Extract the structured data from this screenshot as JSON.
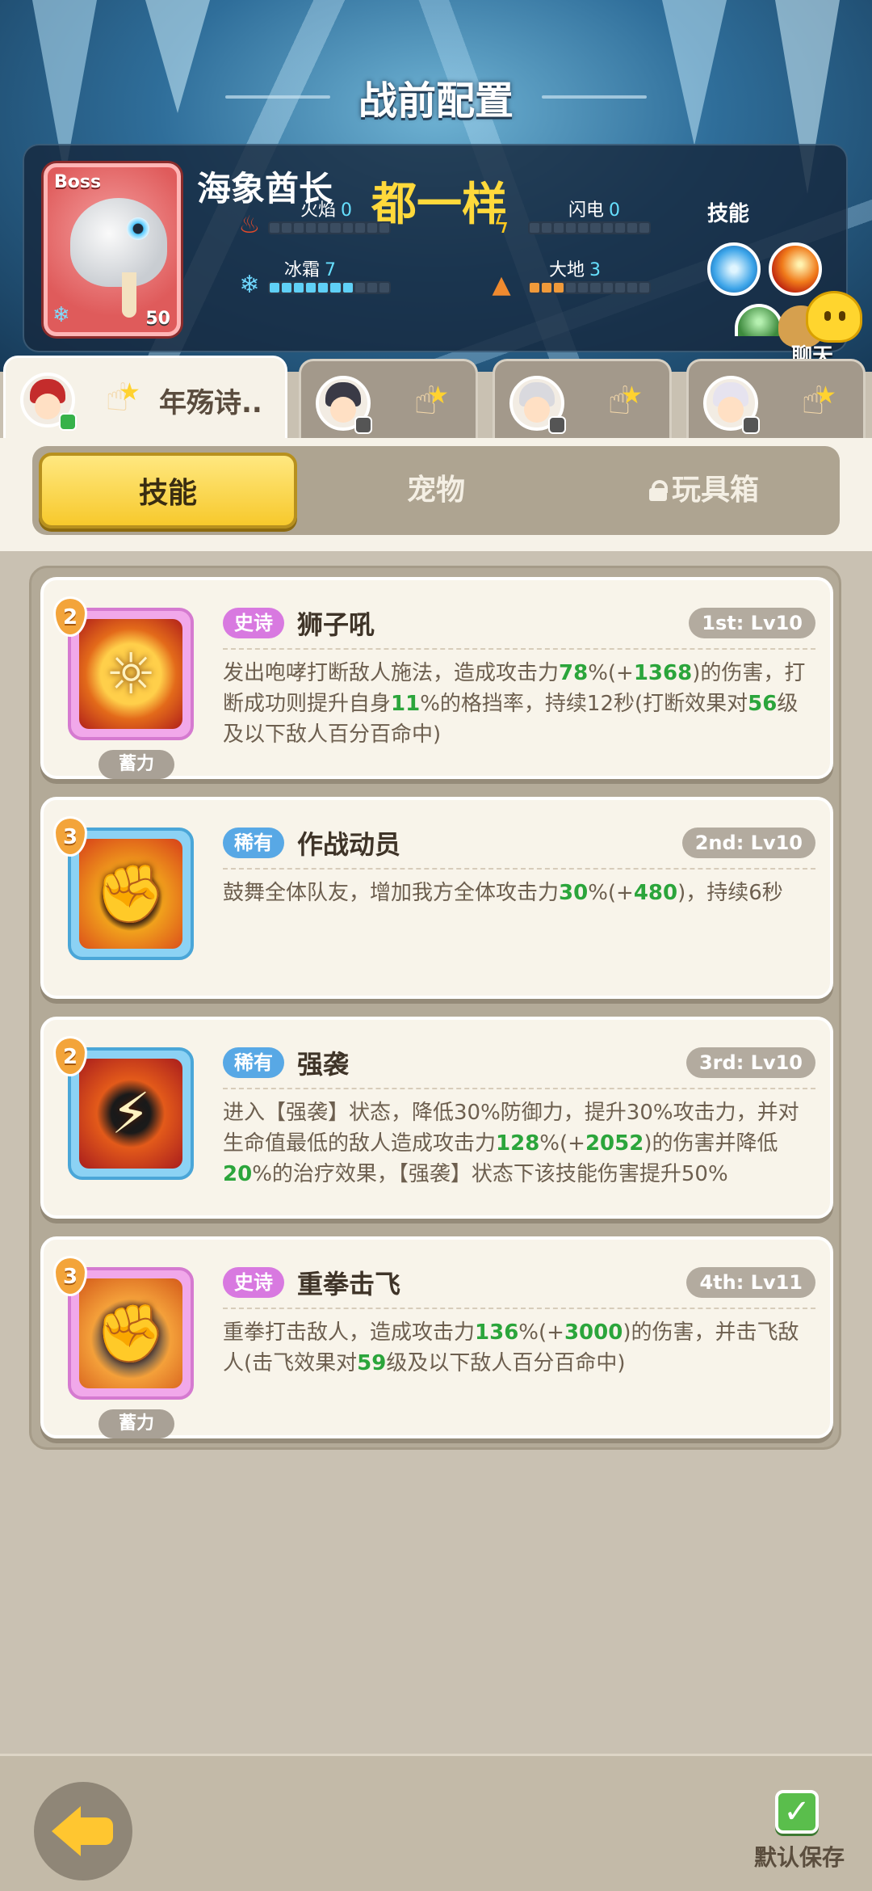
{
  "header": {
    "title": "战前配置"
  },
  "boss": {
    "tag": "Boss",
    "name": "海象酋长",
    "level": "50",
    "note": "都一样",
    "stats": [
      {
        "label": "火焰",
        "value": "0",
        "icon": "fire-icon"
      },
      {
        "label": "闪电",
        "value": "0",
        "icon": "lightning-icon"
      },
      {
        "label": "冰霜",
        "value": "7",
        "icon": "snowflake-icon"
      },
      {
        "label": "大地",
        "value": "3",
        "icon": "earth-icon"
      }
    ],
    "skills_label": "技能"
  },
  "chat": {
    "label": "聊天"
  },
  "heroes": [
    {
      "name": "年殇诗..",
      "active": true
    },
    {
      "name": "",
      "active": false
    },
    {
      "name": "",
      "active": false
    },
    {
      "name": "",
      "active": false
    }
  ],
  "tabs": {
    "skills": "技能",
    "pets": "宠物",
    "toybox": "玩具箱"
  },
  "skills": [
    {
      "cost": "2",
      "rarity": "史诗",
      "name": "狮子吼",
      "slot": "1st: Lv10",
      "charge": "蓄力",
      "desc": [
        {
          "t": "发出咆哮打断敌人施法，造成攻击力"
        },
        {
          "t": "78",
          "hl": true
        },
        {
          "t": "%(+"
        },
        {
          "t": "1368",
          "hl": true
        },
        {
          "t": ")的伤害，打断成功则提升自身"
        },
        {
          "t": "11",
          "hl": true
        },
        {
          "t": "%的格挡率，持续12秒(打断效果对"
        },
        {
          "t": "56",
          "hl": true
        },
        {
          "t": "级及以下敌人百分百命中)"
        }
      ]
    },
    {
      "cost": "3",
      "rarity": "稀有",
      "name": "作战动员",
      "slot": "2nd: Lv10",
      "desc": [
        {
          "t": "鼓舞全体队友，增加我方全体攻击力"
        },
        {
          "t": "30",
          "hl": true
        },
        {
          "t": "%(+"
        },
        {
          "t": "480",
          "hl": true
        },
        {
          "t": ")，持续6秒"
        }
      ]
    },
    {
      "cost": "2",
      "rarity": "稀有",
      "name": "强袭",
      "slot": "3rd: Lv10",
      "desc": [
        {
          "t": "进入【强袭】状态，降低30%防御力，提升30%攻击力，并对生命值最低的敌人造成攻击力"
        },
        {
          "t": "128",
          "hl": true
        },
        {
          "t": "%(+"
        },
        {
          "t": "2052",
          "hl": true
        },
        {
          "t": ")的伤害并降低"
        },
        {
          "t": "20",
          "hl": true
        },
        {
          "t": "%的治疗效果，【强袭】状态下该技能伤害提升50%"
        }
      ]
    },
    {
      "cost": "3",
      "rarity": "史诗",
      "name": "重拳击飞",
      "slot": "4th: Lv11",
      "charge": "蓄力",
      "desc": [
        {
          "t": "重拳打击敌人，造成攻击力"
        },
        {
          "t": "136",
          "hl": true
        },
        {
          "t": "%(+"
        },
        {
          "t": "3000",
          "hl": true
        },
        {
          "t": ")的伤害，并击飞敌人(击飞效果对"
        },
        {
          "t": "59",
          "hl": true
        },
        {
          "t": "级及以下敌人百分百命中)"
        }
      ]
    }
  ],
  "footer": {
    "save_label": "默认保存"
  }
}
